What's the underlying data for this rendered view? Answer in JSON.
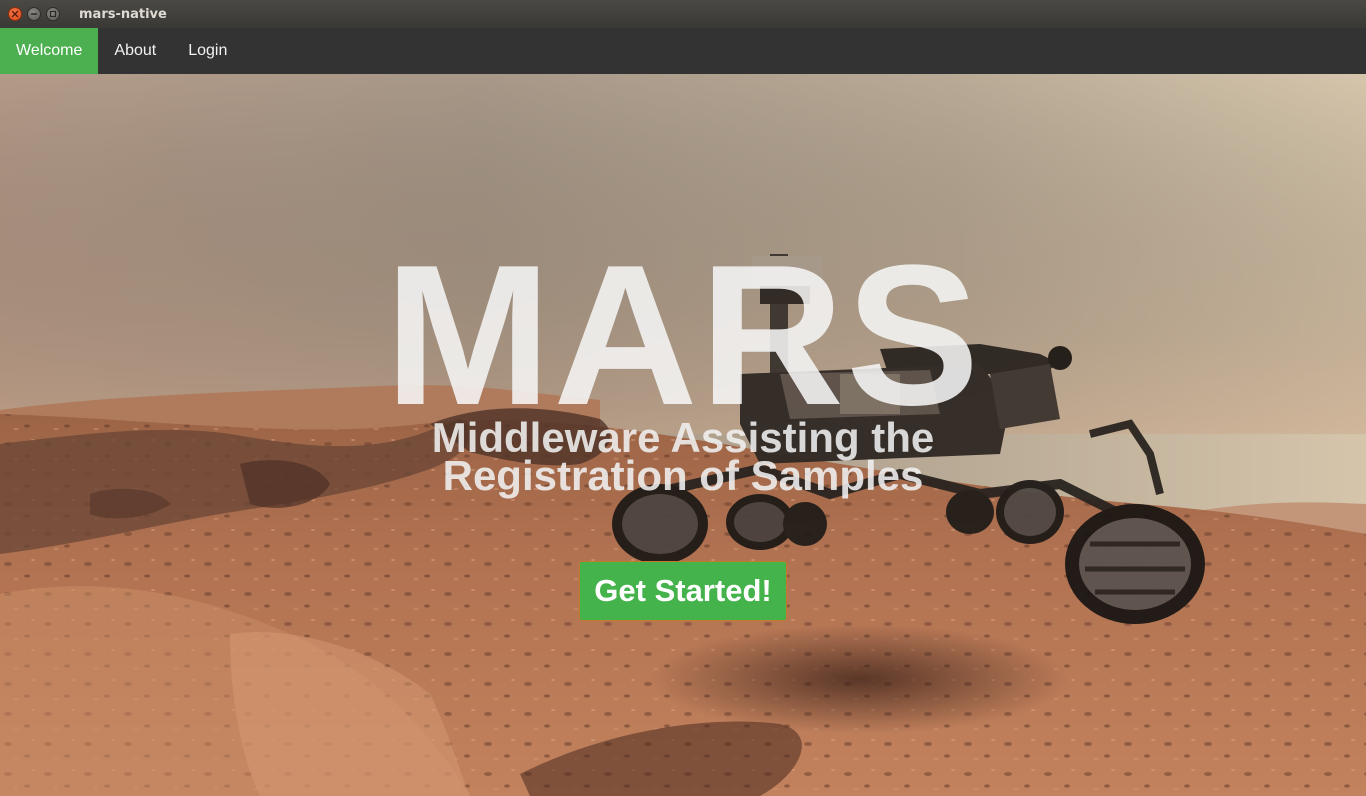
{
  "window": {
    "title": "mars-native",
    "controls": [
      {
        "name": "close",
        "icon": "close-icon",
        "color": "#e95420"
      },
      {
        "name": "minimize",
        "icon": "minimize-icon",
        "color": "#7a7873"
      },
      {
        "name": "maximize",
        "icon": "maximize-icon",
        "color": "#7a7873"
      }
    ]
  },
  "nav": {
    "items": [
      {
        "label": "Welcome",
        "active": true
      },
      {
        "label": "About",
        "active": false
      },
      {
        "label": "Login",
        "active": false
      }
    ],
    "background": "#333333",
    "active_color": "#4caf50"
  },
  "hero": {
    "title": "MARS",
    "subtitle_line1": "Middleware Assisting the",
    "subtitle_line2": "Registration of Samples",
    "button_label": "Get Started!",
    "button_color": "#45b34b",
    "background_image": "mars-rover-landscape-photo"
  }
}
